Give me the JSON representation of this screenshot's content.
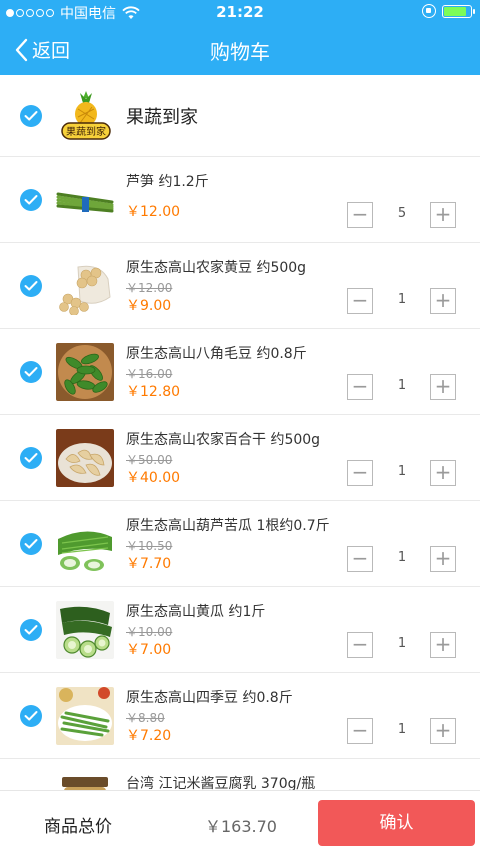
{
  "status_bar": {
    "carrier": "中国电信",
    "time": "21:22",
    "battery_level": 0.85
  },
  "header": {
    "back_label": "返回",
    "title": "购物车"
  },
  "store": {
    "name": "果蔬到家",
    "logo_text": "果蔬到家"
  },
  "items": [
    {
      "name": "芦笋 约1.2斤",
      "old_price": "",
      "price": "￥12.00",
      "qty": "5",
      "minus": "−",
      "plus": "+"
    },
    {
      "name": "原生态高山农家黄豆 约500g",
      "old_price": "￥12.00",
      "price": "￥9.00",
      "qty": "1",
      "minus": "−",
      "plus": "+"
    },
    {
      "name": "原生态高山八角毛豆 约0.8斤",
      "old_price": "￥16.00",
      "price": "￥12.80",
      "qty": "1",
      "minus": "−",
      "plus": "+"
    },
    {
      "name": "原生态高山农家百合干 约500g",
      "old_price": "￥50.00",
      "price": "￥40.00",
      "qty": "1",
      "minus": "−",
      "plus": "+"
    },
    {
      "name": "原生态高山葫芦苦瓜 1根约0.7斤",
      "old_price": "￥10.50",
      "price": "￥7.70",
      "qty": "1",
      "minus": "−",
      "plus": "+"
    },
    {
      "name": "原生态高山黄瓜 约1斤",
      "old_price": "￥10.00",
      "price": "￥7.00",
      "qty": "1",
      "minus": "−",
      "plus": "+"
    },
    {
      "name": "原生态高山四季豆 约0.8斤",
      "old_price": "￥8.80",
      "price": "￥7.20",
      "qty": "1",
      "minus": "−",
      "plus": "+"
    },
    {
      "name": "台湾 江记米酱豆腐乳 370g/瓶"
    }
  ],
  "footer": {
    "total_label": "商品总价",
    "total_value": "￥163.70",
    "confirm_label": "确认"
  },
  "colors": {
    "accent": "#2daef5",
    "price": "#ff7a00",
    "confirm": "#f25858"
  }
}
